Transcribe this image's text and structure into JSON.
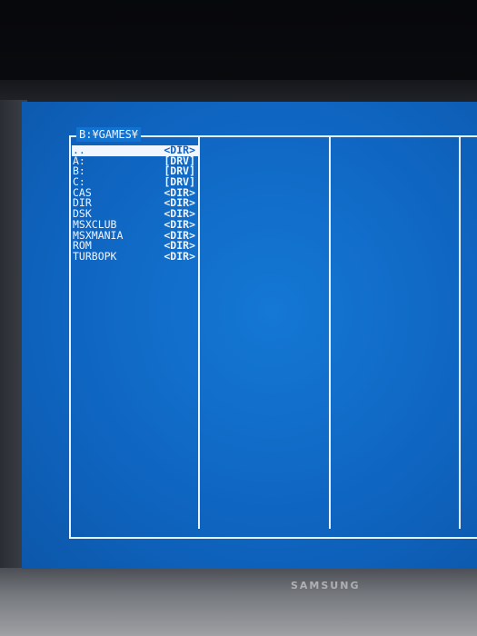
{
  "screen": {
    "path": "B:¥GAMES¥",
    "brand": "SAMSUNG"
  },
  "file_list": {
    "items": [
      {
        "name": "..",
        "tag": "<DIR>"
      },
      {
        "name": "A:",
        "tag": "[DRV]"
      },
      {
        "name": "B:",
        "tag": "[DRV]"
      },
      {
        "name": "C:",
        "tag": "[DRV]"
      },
      {
        "name": "CAS",
        "tag": "<DIR>"
      },
      {
        "name": "DIR",
        "tag": "<DIR>"
      },
      {
        "name": "DSK",
        "tag": "<DIR>"
      },
      {
        "name": "MSXCLUB",
        "tag": "<DIR>"
      },
      {
        "name": "MSXMANIA",
        "tag": "<DIR>"
      },
      {
        "name": "ROM",
        "tag": "<DIR>"
      },
      {
        "name": "TURBOPK",
        "tag": "<DIR>"
      }
    ],
    "selected_index": 0
  },
  "colors": {
    "screen_bg": "#1172cf",
    "text": "#eef5ff",
    "highlight_bg": "#f1f6ff",
    "highlight_text": "#1060c0"
  }
}
